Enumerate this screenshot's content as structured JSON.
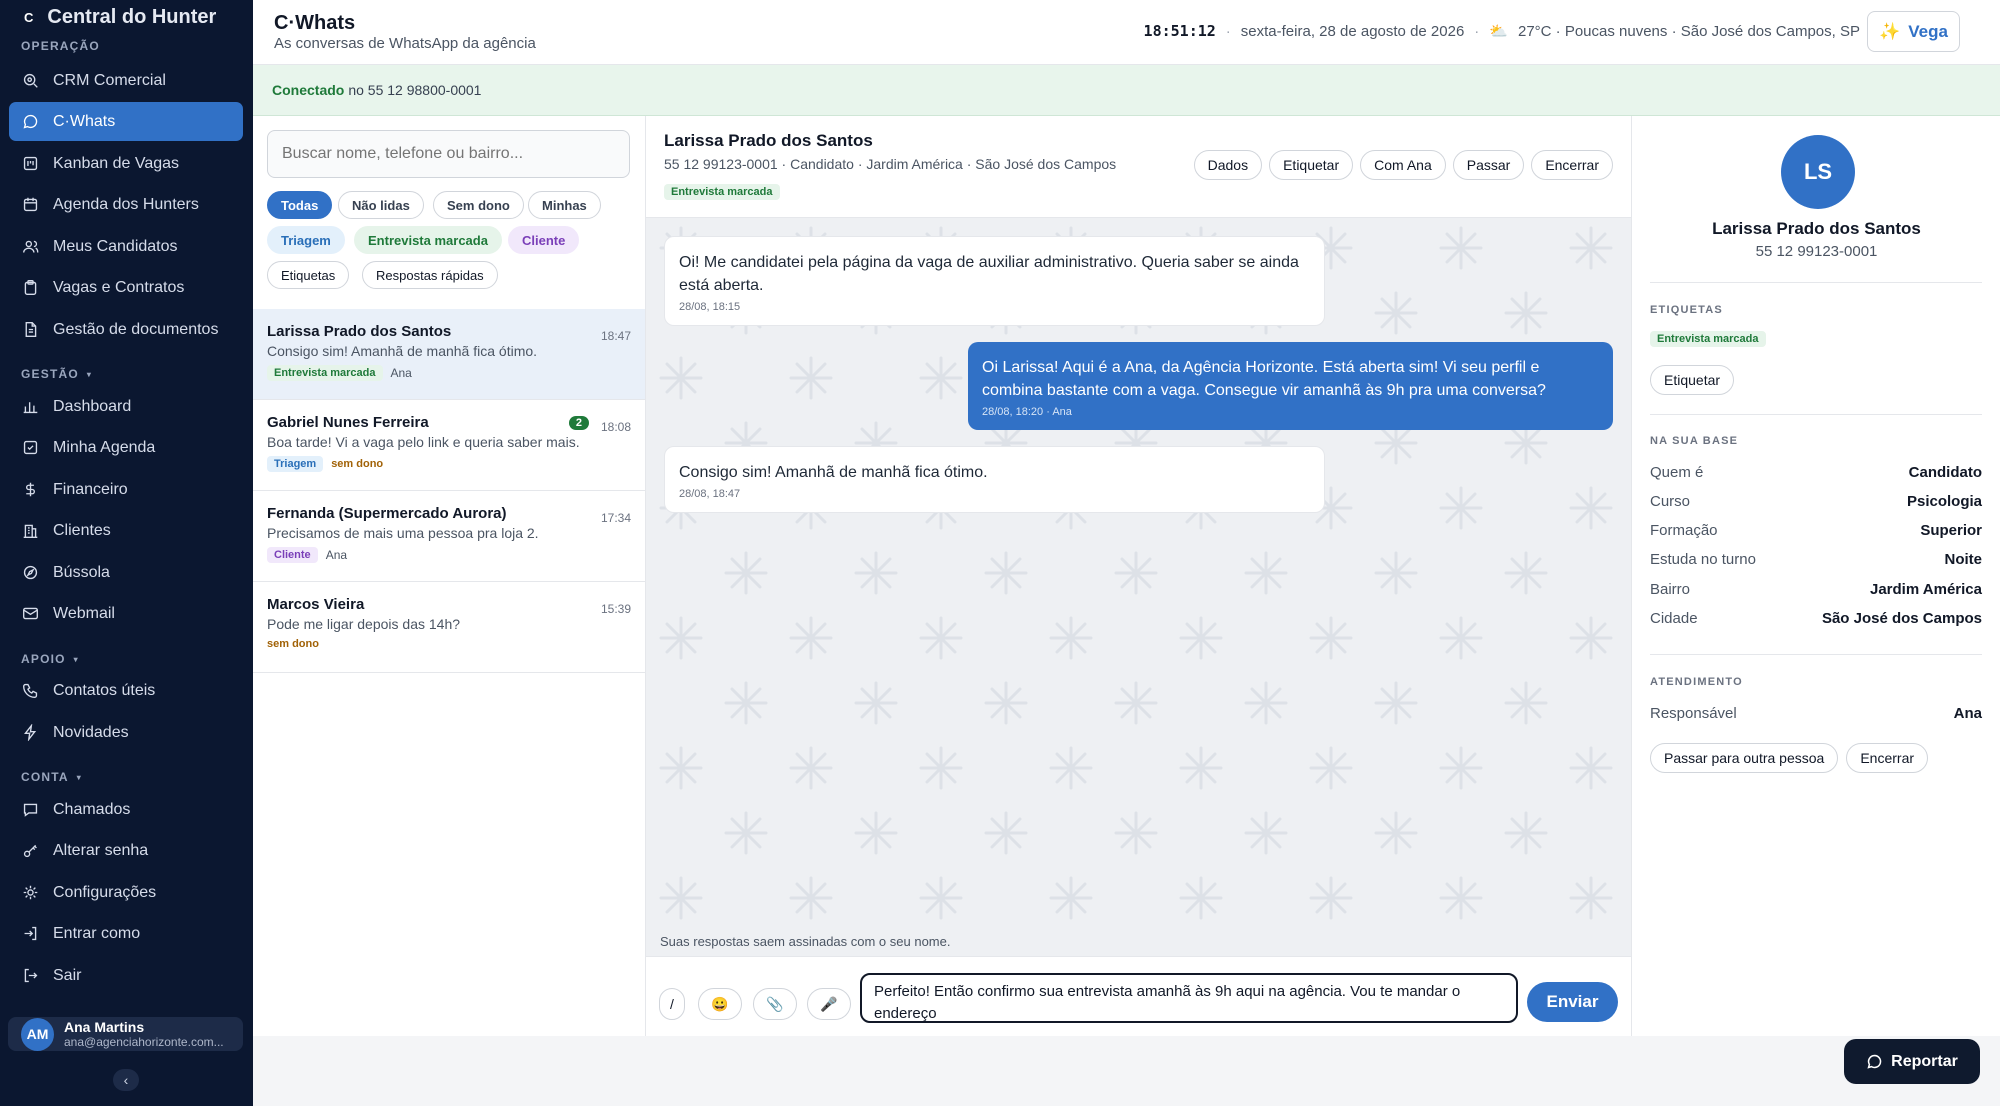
{
  "sidebar": {
    "brand": "Central do Hunter",
    "logo": "C",
    "sections": {
      "operacao": "OPERAÇÃO",
      "gestao": "GESTÃO",
      "apoio": "APOIO",
      "conta": "CONTA"
    },
    "items": [
      {
        "label": "CRM Comercial",
        "icon": "search-icon"
      },
      {
        "label": "C·Whats",
        "icon": "chat-icon"
      },
      {
        "label": "Kanban de Vagas",
        "icon": "kanban-icon"
      },
      {
        "label": "Agenda dos Hunters",
        "icon": "calendar-icon"
      },
      {
        "label": "Meus Candidatos",
        "icon": "users-icon"
      },
      {
        "label": "Vagas e Contratos",
        "icon": "clipboard-icon"
      },
      {
        "label": "Gestão de documentos",
        "icon": "document-icon"
      },
      {
        "label": "Dashboard",
        "icon": "bar-chart-icon"
      },
      {
        "label": "Minha Agenda",
        "icon": "checkbox-icon"
      },
      {
        "label": "Financeiro",
        "icon": "dollar-icon"
      },
      {
        "label": "Clientes",
        "icon": "building-icon"
      },
      {
        "label": "Bússola",
        "icon": "compass-icon"
      },
      {
        "label": "Webmail",
        "icon": "mail-icon"
      },
      {
        "label": "Contatos úteis",
        "icon": "phone-icon"
      },
      {
        "label": "Novidades",
        "icon": "bolt-icon"
      },
      {
        "label": "Chamados",
        "icon": "chat-icon"
      },
      {
        "label": "Alterar senha",
        "icon": "key-icon"
      },
      {
        "label": "Configurações",
        "icon": "gear-icon"
      },
      {
        "label": "Entrar como",
        "icon": "login-icon"
      },
      {
        "label": "Sair",
        "icon": "logout-icon"
      }
    ],
    "user": {
      "initials": "AM",
      "name": "Ana Martins",
      "email": "ana@agenciahorizonte.com..."
    },
    "collapse": "‹"
  },
  "header": {
    "title": "C·Whats",
    "subtitle": "As conversas de WhatsApp da agência",
    "clock": "18:51:12",
    "date": "sexta-feira, 28 de agosto de 2026",
    "weather": "27°C · Poucas nuvens · São José dos Campos, SP",
    "vega": "Vega"
  },
  "connection": {
    "status": "Conectado",
    "text": "no 55 12 98800-0001"
  },
  "list": {
    "search_placeholder": "Buscar nome, telefone ou bairro...",
    "filters": [
      "Todas",
      "Não lidas",
      "Sem dono",
      "Minhas"
    ],
    "tag_filters": [
      "Triagem",
      "Entrevista marcada",
      "Cliente"
    ],
    "tools": [
      "Etiquetas",
      "Respostas rápidas"
    ],
    "conversations": [
      {
        "name": "Larissa Prado dos Santos",
        "preview": "Consigo sim! Amanhã de manhã fica ótimo.",
        "time": "18:47",
        "tag": "Entrevista marcada",
        "owner": "Ana",
        "badge": ""
      },
      {
        "name": "Gabriel Nunes Ferreira",
        "preview": "Boa tarde! Vi a vaga pelo link e queria saber mais.",
        "time": "18:08",
        "tag": "Triagem",
        "owner": "sem dono",
        "badge": "2"
      },
      {
        "name": "Fernanda (Supermercado Aurora)",
        "preview": "Precisamos de mais uma pessoa pra loja 2.",
        "time": "17:34",
        "tag": "Cliente",
        "owner": "Ana",
        "badge": ""
      },
      {
        "name": "Marcos Vieira",
        "preview": "Pode me ligar depois das 14h?",
        "time": "15:39",
        "tag": "",
        "owner": "sem dono",
        "badge": ""
      }
    ]
  },
  "chat": {
    "name": "Larissa Prado dos Santos",
    "sub": "55 12 99123-0001 · Candidato · Jardim América · São José dos Campos",
    "tag": "Entrevista marcada",
    "actions": [
      "Dados",
      "Etiquetar",
      "Com Ana",
      "Passar",
      "Encerrar"
    ],
    "messages": [
      {
        "dir": "in",
        "text": "Oi! Me candidatei pela página da vaga de auxiliar administrativo. Queria saber se ainda está aberta.",
        "meta": "28/08, 18:15"
      },
      {
        "dir": "out",
        "text": "Oi Larissa! Aqui é a Ana, da Agência Horizonte. Está aberta sim! Vi seu perfil e combina bastante com a vaga. Consegue vir amanhã às 9h pra uma conversa?",
        "meta": "28/08, 18:20 · Ana"
      },
      {
        "dir": "in",
        "text": "Consigo sim! Amanhã de manhã fica ótimo.",
        "meta": "28/08, 18:47"
      }
    ],
    "sign_note": "Suas respostas saem assinadas com o seu nome.",
    "tools": [
      "/",
      "😀",
      "📎",
      "🎤"
    ],
    "draft": "Perfeito! Então confirmo sua entrevista amanhã às 9h aqui na agência. Vou te mandar o endereço",
    "send": "Enviar"
  },
  "profile": {
    "initials": "LS",
    "name": "Larissa Prado dos Santos",
    "phone": "55 12 99123-0001",
    "etiquetas_title": "ETIQUETAS",
    "tag": "Entrevista marcada",
    "etiquetar": "Etiquetar",
    "base_title": "NA SUA BASE",
    "base": [
      {
        "k": "Quem é",
        "v": "Candidato"
      },
      {
        "k": "Curso",
        "v": "Psicologia"
      },
      {
        "k": "Formação",
        "v": "Superior"
      },
      {
        "k": "Estuda no turno",
        "v": "Noite"
      },
      {
        "k": "Bairro",
        "v": "Jardim América"
      },
      {
        "k": "Cidade",
        "v": "São José dos Campos"
      }
    ],
    "atendimento_title": "ATENDIMENTO",
    "responsavel_k": "Responsável",
    "responsavel_v": "Ana",
    "pass_button": "Passar para outra pessoa",
    "end_button": "Encerrar"
  },
  "reportar": "Reportar"
}
